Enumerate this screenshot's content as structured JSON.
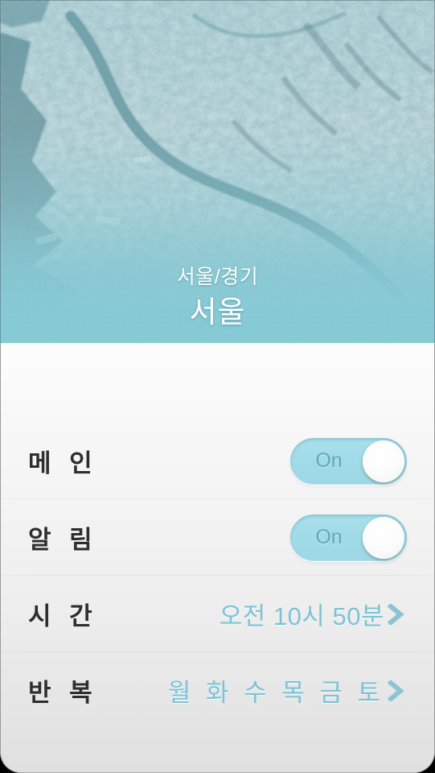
{
  "hero": {
    "region": "서울/경기",
    "city": "서울",
    "map_icon": "satellite-map-seoul",
    "tint_color": "#86cad6"
  },
  "theme": {
    "accent": "#7cc3d6",
    "toggle_track": "#a2dbe8",
    "toggle_text": "#5fa9bb",
    "label_text": "#2e2e2e",
    "panel_bg": "#f2f2f2"
  },
  "rows": [
    {
      "id": "main",
      "label": "메 인",
      "type": "toggle",
      "value": "On"
    },
    {
      "id": "alarm",
      "label": "알 림",
      "type": "toggle",
      "value": "On"
    },
    {
      "id": "time",
      "label": "시 간",
      "type": "nav",
      "value": "오전 10시 50분",
      "chevron_icon": "chevron-right-icon"
    },
    {
      "id": "repeat",
      "label": "반 복",
      "type": "nav",
      "value": "월 화 수 목 금 토",
      "chevron_icon": "chevron-right-icon"
    }
  ]
}
